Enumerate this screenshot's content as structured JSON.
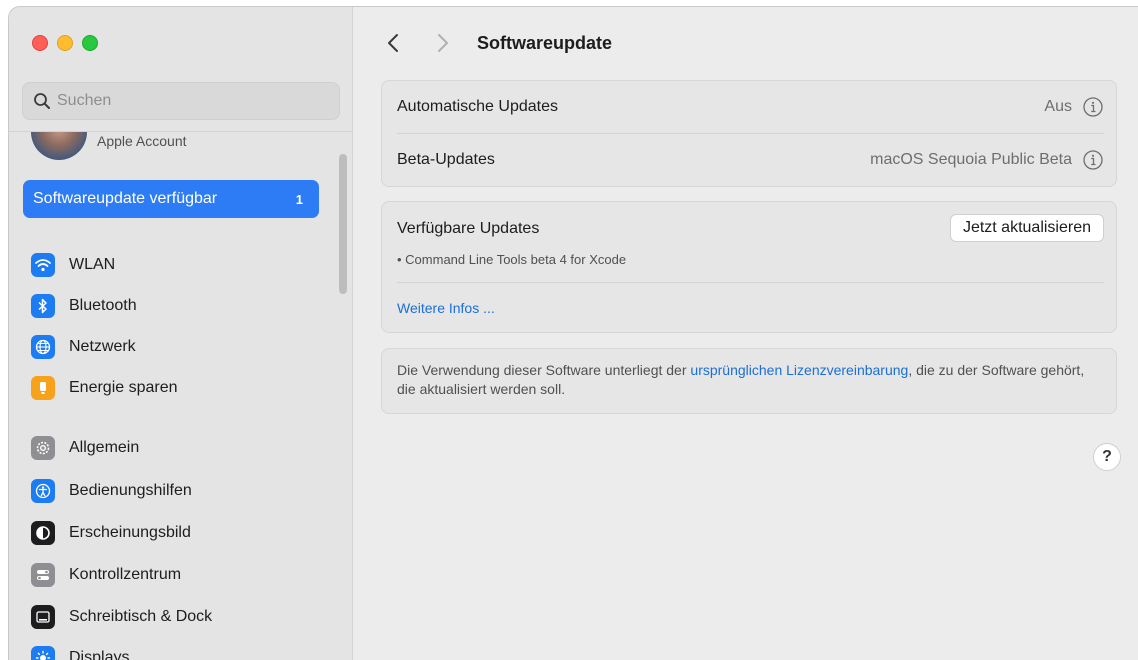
{
  "window": {
    "controls": [
      "close",
      "minimize",
      "zoom"
    ]
  },
  "sidebar": {
    "search": {
      "placeholder": "Suchen",
      "value": ""
    },
    "account": {
      "label": "Apple Account"
    },
    "update_item": {
      "label": "Softwareupdate verfügbar",
      "badge": "1"
    },
    "items": [
      {
        "label": "WLAN",
        "icon": "wifi-icon",
        "color": "#1e7cf2"
      },
      {
        "label": "Bluetooth",
        "icon": "bluetooth-icon",
        "color": "#1e7cf2"
      },
      {
        "label": "Netzwerk",
        "icon": "globe-icon",
        "color": "#1e7cf2"
      },
      {
        "label": "Energie sparen",
        "icon": "battery-icon",
        "color": "#f7a21b"
      },
      {
        "label": "Allgemein",
        "icon": "gear-icon",
        "color": "#8e8e93"
      },
      {
        "label": "Bedienungshilfen",
        "icon": "accessibility-icon",
        "color": "#1e7cf2"
      },
      {
        "label": "Erscheinungsbild",
        "icon": "appearance-icon",
        "color": "#1d1d1f"
      },
      {
        "label": "Kontrollzentrum",
        "icon": "control-center-icon",
        "color": "#8e8e93"
      },
      {
        "label": "Schreibtisch & Dock",
        "icon": "dock-icon",
        "color": "#1d1d1f"
      },
      {
        "label": "Displays",
        "icon": "sun-icon",
        "color": "#1e7cf2"
      }
    ]
  },
  "main": {
    "title": "Softwareupdate",
    "settings": {
      "auto_updates": {
        "label": "Automatische Updates",
        "value": "Aus"
      },
      "beta_updates": {
        "label": "Beta-Updates",
        "value": "macOS Sequoia Public Beta"
      }
    },
    "available": {
      "title": "Verfügbare Updates",
      "button": "Jetzt aktualisieren",
      "item": "• Command Line Tools beta 4 for Xcode",
      "more": "Weitere Infos ..."
    },
    "license": {
      "before": "Die Verwendung dieser Software unterliegt der ",
      "link": "ursprünglichen Lizenzvereinbarung",
      "after": ", die zu der Software gehört, die aktualisiert werden soll."
    },
    "help": "?"
  }
}
